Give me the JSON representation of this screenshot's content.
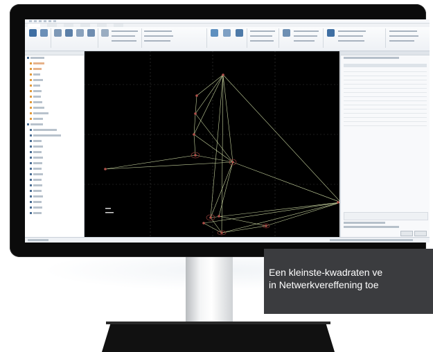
{
  "caption": {
    "line1": "Een kleinste-kwadraten ve",
    "line2": "in Netwerkvereffening toe"
  },
  "colors": {
    "caption_bg": "#3b3c3f",
    "viewport_bg": "#000000",
    "network_line": "#c9d6a0",
    "station_marker": "#b0504a",
    "bezel": "#0b0b0b"
  },
  "icons": [
    "monitor-bezel",
    "ribbon-icons",
    "tree-node-icons"
  ]
}
